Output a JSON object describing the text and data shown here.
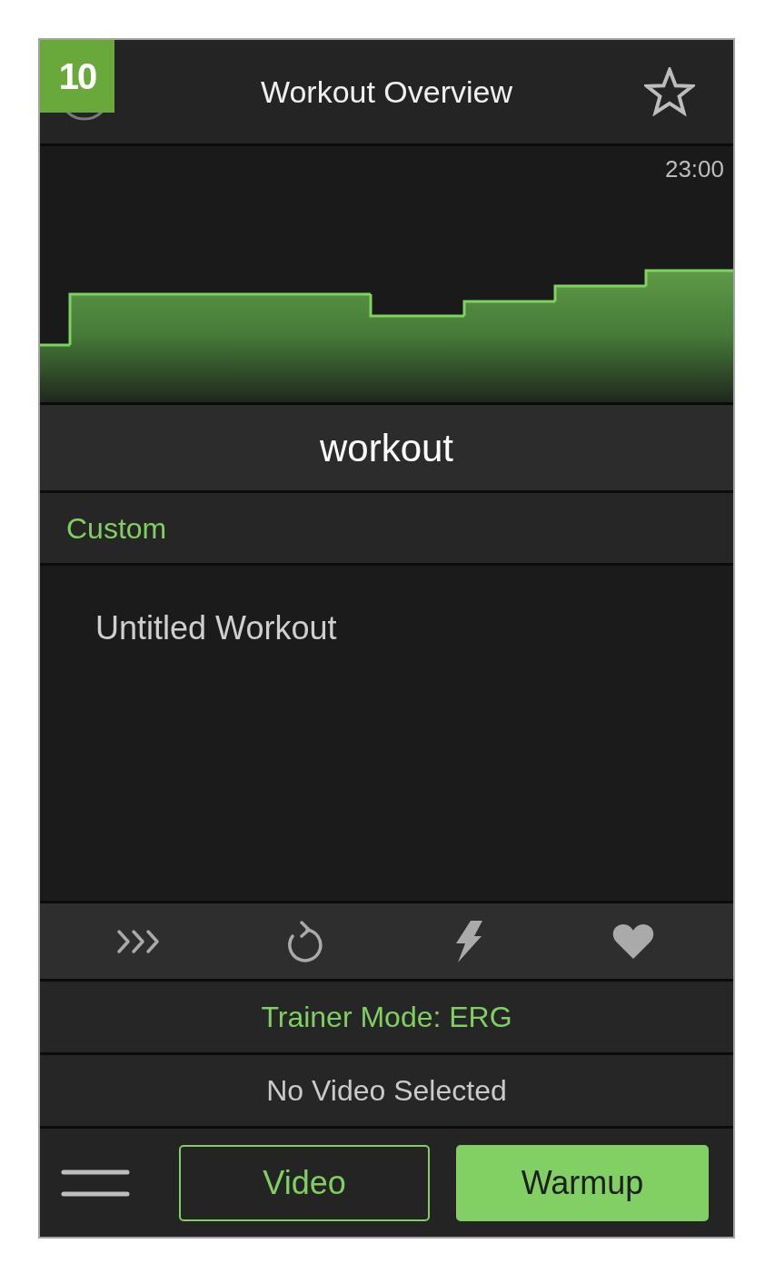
{
  "step_badge": "10",
  "header": {
    "title": "Workout Overview",
    "favorite": false
  },
  "chart": {
    "duration": "23:00"
  },
  "workout": {
    "name": "workout",
    "category": "Custom",
    "description": "Untitled Workout"
  },
  "trainer_mode": "Trainer Mode: ERG",
  "video_status": "No Video Selected",
  "buttons": [
    {
      "label": "Video",
      "kind": "outline"
    },
    {
      "label": "Warmup",
      "kind": "filled"
    }
  ]
}
